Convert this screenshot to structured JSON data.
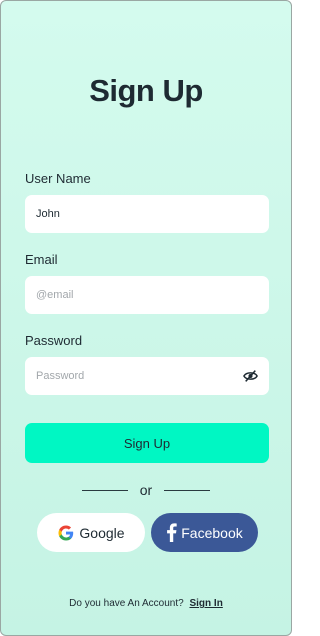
{
  "page": {
    "title": "Sign Up"
  },
  "form": {
    "username": {
      "label": "User Name",
      "value": "John",
      "placeholder": ""
    },
    "email": {
      "label": "Email",
      "value": "",
      "placeholder": "@email"
    },
    "password": {
      "label": "Password",
      "value": "",
      "placeholder": "Password",
      "toggle_icon": "eye-off-icon"
    },
    "submit_label": "Sign Up"
  },
  "divider": {
    "text": "or"
  },
  "social": {
    "google": {
      "label": "Google",
      "icon": "google-icon"
    },
    "facebook": {
      "label": "Facebook",
      "icon": "facebook-icon"
    }
  },
  "footer": {
    "prompt": "Do you have An Account?",
    "link": "Sign In"
  },
  "colors": {
    "background": "#d4fbee",
    "primary": "#00f7c3",
    "facebook": "#3b5897",
    "text": "#1e2a32"
  }
}
